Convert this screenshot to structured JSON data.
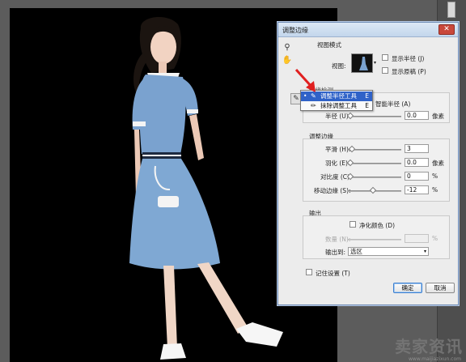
{
  "dialog": {
    "title": "调整边缘",
    "close_glyph": "✕",
    "view_mode": {
      "heading": "视图模式",
      "view_label": "视图:",
      "show_radius": "显示半径 (J)",
      "show_original": "显示原稿 (P)"
    },
    "edge_detection": {
      "heading": "边缘检测",
      "smart_radius": "智能半径 (A)",
      "radius_label": "半径 (U):",
      "radius_value": "0.0",
      "radius_unit": "像素"
    },
    "adjust_edge": {
      "heading": "调整边缘",
      "smooth_label": "平滑 (H):",
      "smooth_value": "3",
      "feather_label": "羽化 (E):",
      "feather_value": "0.0",
      "feather_unit": "像素",
      "contrast_label": "对比度 (C):",
      "contrast_value": "0",
      "contrast_unit": "%",
      "shift_label": "移动边缘 (S):",
      "shift_value": "-12",
      "shift_unit": "%"
    },
    "output": {
      "heading": "输出",
      "decontaminate": "净化颜色 (D)",
      "amount_label": "数量 (N):",
      "amount_unit": "%",
      "output_to_label": "输出到:",
      "output_to_value": "选区"
    },
    "remember": "记住设置 (T)",
    "ok": "确定",
    "cancel": "取消"
  },
  "popup": {
    "items": [
      {
        "label": "调整半径工具",
        "key": "E"
      },
      {
        "label": "抹除调整工具",
        "key": "E"
      }
    ]
  },
  "watermark": {
    "text": "卖家资讯",
    "url": "www.maijiazixun.com"
  },
  "colors": {
    "accent": "#2f62c8",
    "close": "#c9483b",
    "arrow": "#e02020"
  }
}
